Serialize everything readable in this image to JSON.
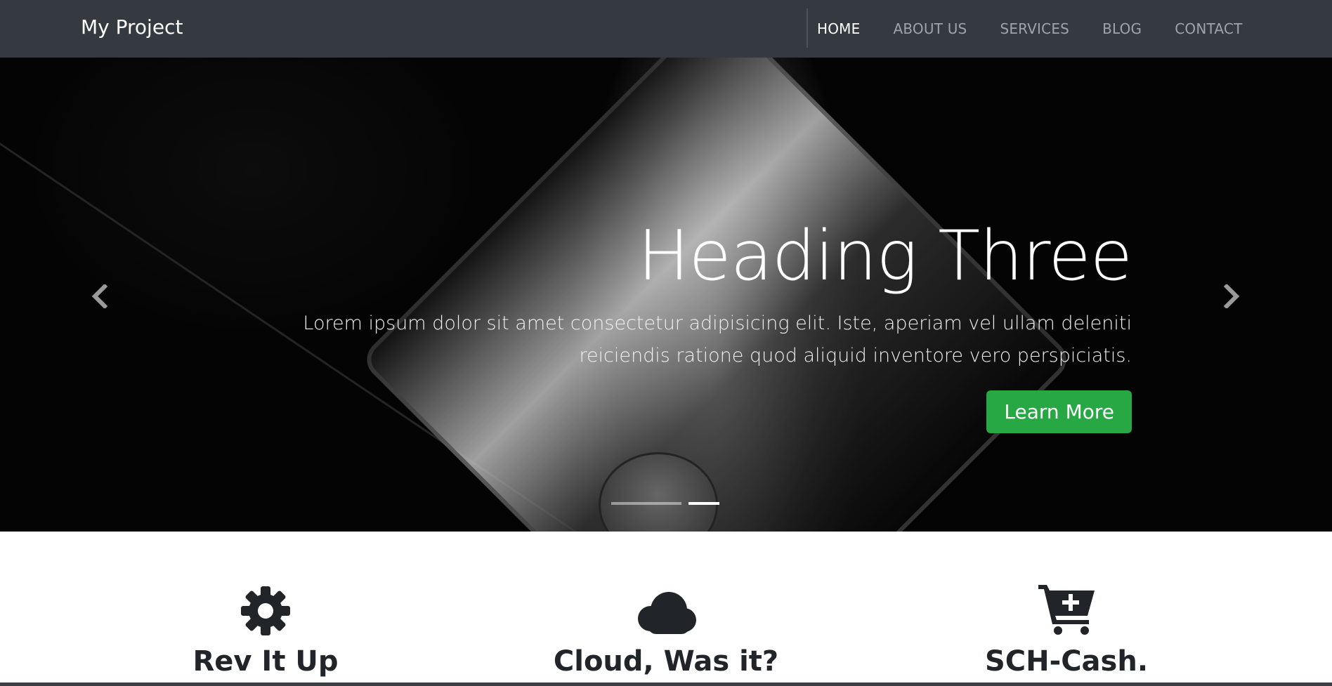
{
  "navbar": {
    "brand": "My Project",
    "links": [
      {
        "label": "HOME",
        "active": true
      },
      {
        "label": "ABOUT US",
        "active": false
      },
      {
        "label": "SERVICES",
        "active": false
      },
      {
        "label": "BLOG",
        "active": false
      },
      {
        "label": "CONTACT",
        "active": false
      }
    ],
    "background": "#343a40"
  },
  "carousel": {
    "heading": "Heading Three",
    "text": "Lorem ipsum dolor sit amet consectetur adipisicing elit. Iste, aperiam vel ullam deleniti reiciendis ratione quod aliquid inventore vero perspiciatis.",
    "button_label": "Learn More",
    "button_color": "#28a745",
    "prev_icon": "chevron-left-icon",
    "next_icon": "chevron-right-icon",
    "slide_count": 2,
    "active_slide": 2
  },
  "features": [
    {
      "icon": "gear-icon",
      "title": "Rev It Up"
    },
    {
      "icon": "cloud-icon",
      "title": "Cloud, Was it?"
    },
    {
      "icon": "cart-plus-icon",
      "title": "SCH-Cash."
    }
  ]
}
